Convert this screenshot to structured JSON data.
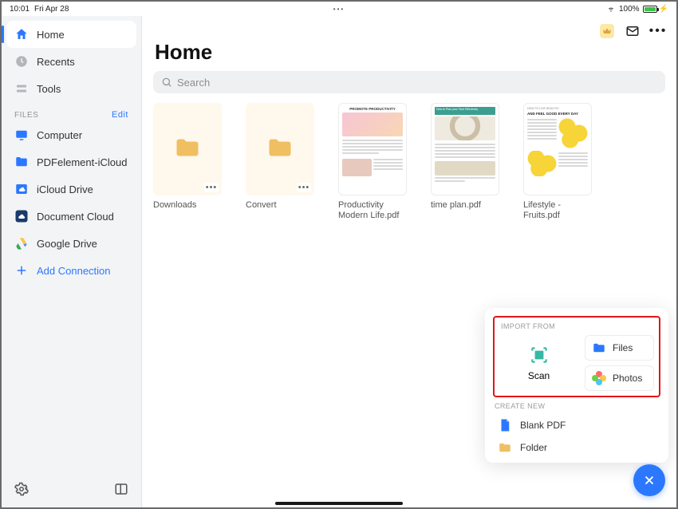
{
  "status": {
    "time": "10:01",
    "date": "Fri Apr 28",
    "battery": "100%"
  },
  "sidebar": {
    "nav": [
      {
        "label": "Home"
      },
      {
        "label": "Recents"
      },
      {
        "label": "Tools"
      }
    ],
    "files_section": "FILES",
    "edit": "Edit",
    "locations": [
      {
        "label": "Computer"
      },
      {
        "label": "PDFelement-iCloud"
      },
      {
        "label": "iCloud Drive"
      },
      {
        "label": "Document Cloud"
      },
      {
        "label": "Google Drive"
      }
    ],
    "add_connection": "Add Connection"
  },
  "main": {
    "title": "Home",
    "search_placeholder": "Search",
    "items": [
      {
        "label": "Downloads"
      },
      {
        "label": "Convert"
      },
      {
        "label": "Productivity Modern Life.pdf"
      },
      {
        "label": "time plan.pdf"
      },
      {
        "label": "Lifestyle - Fruits.pdf"
      }
    ],
    "doc_headers": {
      "productivity": "PROMOTE PRODUCTIVITY",
      "timeplan": "How to Plan your Time Effectively",
      "lifestyle_small": "HOW TO LIVE HEALTHY",
      "lifestyle": "AND FEEL GOOD EVERY DAY"
    }
  },
  "panel": {
    "import_label": "IMPORT FROM",
    "scan": "Scan",
    "files": "Files",
    "photos": "Photos",
    "create_label": "CREATE NEW",
    "blank_pdf": "Blank PDF",
    "folder": "Folder"
  }
}
